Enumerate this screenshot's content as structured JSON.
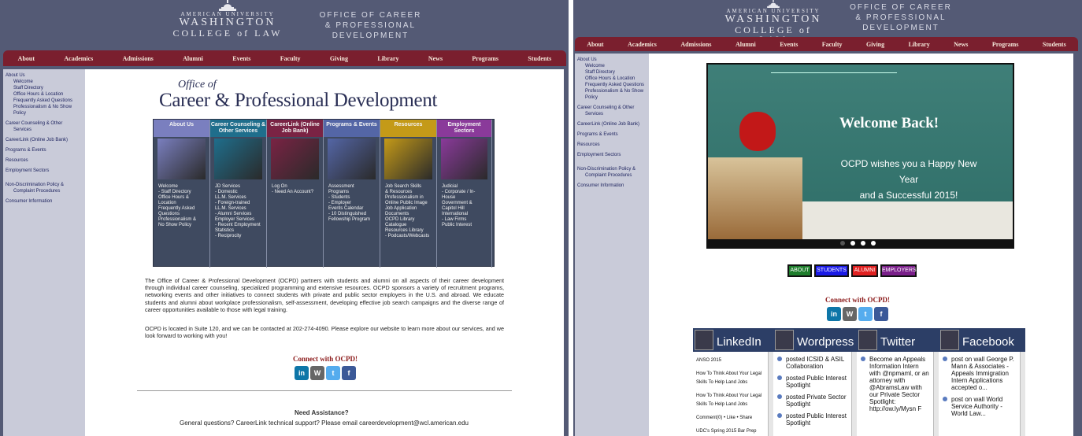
{
  "left": {
    "logo": {
      "line1": "AMERICAN UNIVERSITY",
      "line2": "WASHINGTON",
      "line3": "COLLEGE of LAW"
    },
    "office": [
      "OFFICE OF CAREER",
      "& PROFESSIONAL",
      "DEVELOPMENT"
    ],
    "nav": [
      "About",
      "Academics",
      "Admissions",
      "Alumni",
      "Events",
      "Faculty",
      "Giving",
      "Library",
      "News",
      "Programs",
      "Students"
    ],
    "sidebar": [
      "About Us",
      "Welcome",
      "Staff Directory",
      "Office Hours & Location",
      "Frequently Asked Questions",
      "Professionalism & No Show",
      "Policy",
      "",
      "Career Counseling & Other",
      "Services",
      "",
      "CareerLink (Online Job Bank)",
      "",
      "Programs & Events",
      "",
      "Resources",
      "",
      "Employment Sectors",
      "",
      "",
      "Non-Discrimination Policy &",
      "Complaint Procedures",
      "",
      "Consumer Information"
    ],
    "banner": {
      "line1": "Office of",
      "line2": "Career & Professional Development"
    },
    "tiles": [
      {
        "title": "About Us",
        "color": "#7a7fbf",
        "items": [
          "Welcome",
          "- Staff Directory",
          "Office Hours &",
          "Location",
          "Frequently Asked",
          "Questions",
          "Professionalism &",
          "No Show Policy"
        ]
      },
      {
        "title": "Career Counseling & Other Services",
        "color": "#1f6e8c",
        "items": [
          "JD Services",
          "- Domestic",
          "LL.M. Services",
          "- Foreign-trained",
          "LL.M. Services",
          "- Alumni Services",
          "Employer Services",
          "- Recent Employment",
          "Statistics",
          "- Reciprocity"
        ]
      },
      {
        "title": "CareerLink (Online Job Bank)",
        "color": "#7a2344",
        "items": [
          "Log On",
          "- Need An Account?"
        ]
      },
      {
        "title": "Programs & Events",
        "color": "#5466a6",
        "items": [
          "Assessment",
          "Programs",
          "- Students",
          "- Employer",
          "Events Calendar",
          "- 10 Distinguished",
          "Fellowship Program"
        ]
      },
      {
        "title": "Resources",
        "color": "#c49a18",
        "items": [
          "Job Search Skills",
          "& Resources",
          "Professionalism in",
          "Online Public Image",
          "Job Application",
          "Documents",
          "OCPD Library",
          "Catalogue",
          "Resources Library",
          "- Podcasts/Webcasts"
        ]
      },
      {
        "title": "Employment Sectors",
        "color": "#8a3a9a",
        "items": [
          "Judicial",
          "- Corporate / In-House",
          "Government &",
          "Capitol Hill",
          "International",
          "- Law Firms",
          "Public Interest"
        ]
      }
    ],
    "para1": "The Office of Career & Professional Development (OCPD) partners with students and alumni on all aspects of their career development through individual career counseling, specialized programming and extensive resources. OCPD sponsors a variety of recruitment programs, networking events and other initiatives to connect students with private and public sector employers in the U.S. and abroad. We educate students and alumni about workplace professionalism, self-assessment, developing effective job search campaigns and the diverse range of career opportunities available to those with legal training.",
    "para2": "OCPD is located in Suite 120, and we can be contacted at 202-274-4090. Please explore our website to learn more about our services, and we look forward to working with you!",
    "connect": "Connect with OCPD!",
    "need_help": "Need Assistance?",
    "question": "General questions? CareerLink technical support? Please email careerdevelopment@wcl.american.edu",
    "email": "careerdevelopment@wcl.american.edu"
  },
  "right": {
    "logo": {
      "line1": "AMERICAN UNIVERSITY",
      "line2": "WASHINGTON",
      "line3": "COLLEGE of LAW"
    },
    "office": [
      "OFFICE OF CAREER",
      "& PROFESSIONAL",
      "DEVELOPMENT"
    ],
    "nav": [
      "About",
      "Academics",
      "Admissions",
      "Alumni",
      "Events",
      "Faculty",
      "Giving",
      "Library",
      "News",
      "Programs",
      "Students"
    ],
    "sidebar": [
      "About Us",
      "Welcome",
      "Staff Directory",
      "Office Hours & Location",
      "Frequently Asked Questions",
      "Professionalism & No Show",
      "Policy",
      "",
      "Career Counseling & Other",
      "Services",
      "",
      "CareerLink (Online Job Bank)",
      "",
      "Programs & Events",
      "",
      "Resources",
      "",
      "Employment Sectors",
      "",
      "",
      "Non-Discrimination Policy &",
      "Complaint Procedures",
      "",
      "Consumer Information"
    ],
    "slide": {
      "title": "Welcome Back!",
      "line1": "OCPD wishes you a Happy New Year",
      "line2": "and a Successful 2015!"
    },
    "slide_dots": 4,
    "buttons": [
      {
        "label": "ABOUT",
        "color": "#1e7d2c"
      },
      {
        "label": "STUDENTS",
        "color": "#1a1ae6"
      },
      {
        "label": "ALUMNI",
        "color": "#e02020"
      },
      {
        "label": "EMPLOYERS",
        "color": "#7a1f8a"
      }
    ],
    "connect": "Connect with OCPD!",
    "feeds": [
      {
        "title": "LinkedIn",
        "items": [
          "ANSO 2015",
          "How To Think About Your Legal Skills To Help Land Jobs",
          "How To Think About Your Legal Skills To Help Land Jobs",
          "Comment(0) • Like • Share",
          "UDC's Spring 2015 Bar Prep Lecture Series"
        ]
      },
      {
        "title": "Wordpress",
        "items": [
          "posted ICSID & ASIL Collaboration",
          "posted Public Interest Spotlight",
          "posted Private Sector Spotlight",
          "posted Public Interest Spotlight"
        ]
      },
      {
        "title": "Twitter",
        "items": [
          "Become an Appeals Information Intern with @npmaml, or an attorney with @AbramsLaw with our Private Sector Spotlight: http://ow.ly/Mysn F"
        ]
      },
      {
        "title": "Facebook",
        "items": [
          "post on wall George P. Mann & Associates - Appeals Immigration Intern Applications accepted o...",
          "post on wall World Service Authority - World Law..."
        ]
      }
    ]
  }
}
